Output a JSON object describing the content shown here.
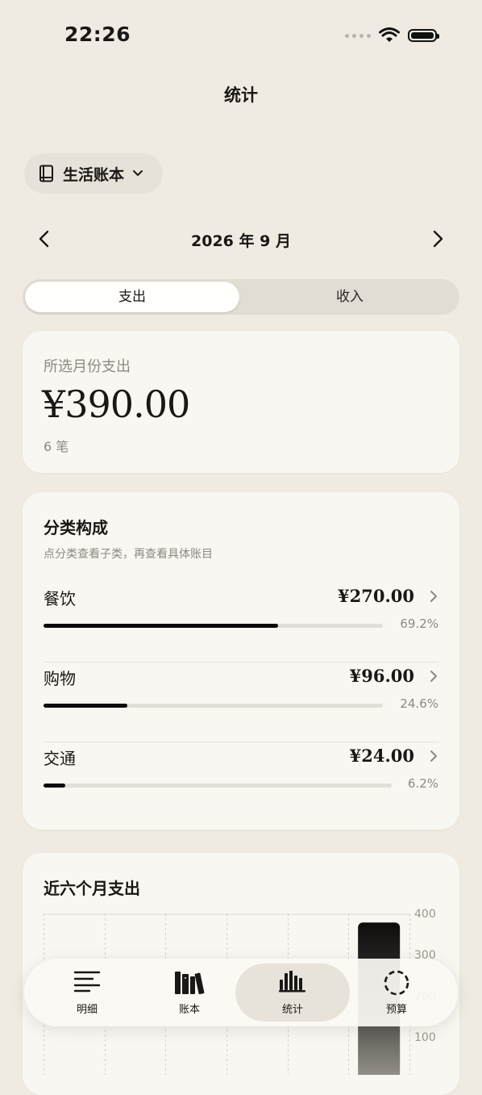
{
  "status_bar": {
    "time": "22:26"
  },
  "header": {
    "title": "统计"
  },
  "ledger": {
    "label": "生活账本"
  },
  "month_nav": {
    "label": "2026 年 9 月"
  },
  "segment": {
    "expense": "支出",
    "income": "收入",
    "selected": "支出"
  },
  "summary": {
    "label": "所选月份支出",
    "amount": "¥390.00",
    "count": "6 笔"
  },
  "categories": {
    "title": "分类构成",
    "subtitle": "点分类查看子类，再查看具体账目",
    "items": [
      {
        "name": "餐饮",
        "amount": "¥270.00",
        "percent": "69.2%",
        "share": 0.692
      },
      {
        "name": "购物",
        "amount": "¥96.00",
        "percent": "24.6%",
        "share": 0.246
      },
      {
        "name": "交通",
        "amount": "¥24.00",
        "percent": "6.2%",
        "share": 0.062
      }
    ]
  },
  "trend": {
    "title": "近六个月支出",
    "y_ticks": [
      "400",
      "300",
      "200",
      "100"
    ]
  },
  "chart_data": {
    "type": "bar",
    "title": "近六个月支出",
    "categories": [
      "",
      "",
      "",
      "",
      "",
      ""
    ],
    "values": [
      0,
      0,
      0,
      0,
      0,
      390
    ],
    "ylim": [
      0,
      400
    ],
    "y_ticks": [
      400,
      300,
      200,
      100
    ],
    "grid": true
  },
  "tabbar": {
    "items": [
      {
        "label": "明细",
        "icon": "list-icon"
      },
      {
        "label": "账本",
        "icon": "books-icon"
      },
      {
        "label": "统计",
        "icon": "bar-chart-icon"
      },
      {
        "label": "预算",
        "icon": "dashed-circle-icon"
      }
    ],
    "active": "统计"
  }
}
